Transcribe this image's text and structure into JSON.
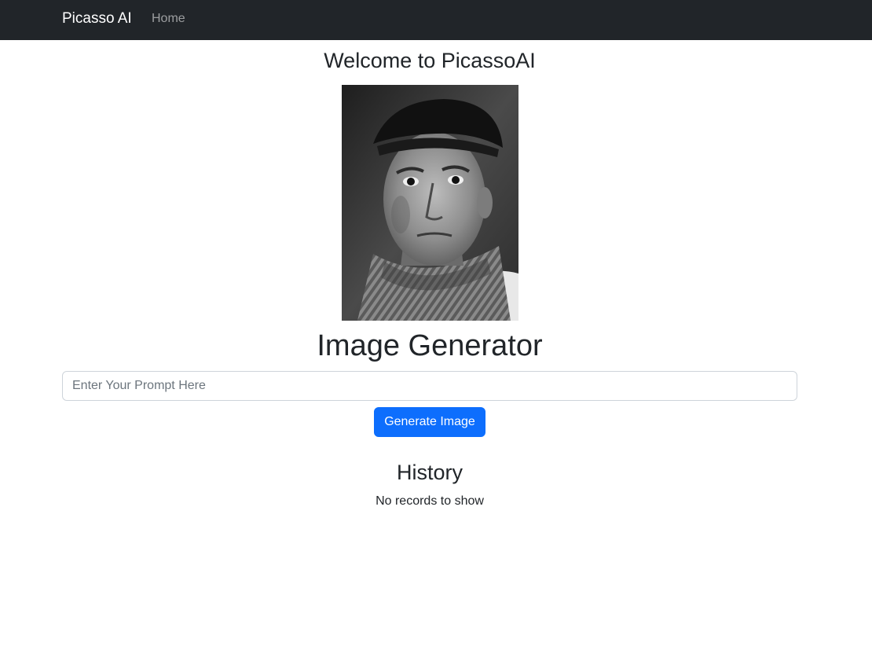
{
  "navbar": {
    "brand": "Picasso AI",
    "links": [
      "Home"
    ]
  },
  "main": {
    "welcome": "Welcome to PicassoAI",
    "portrait_alt": "Portrait photo of Pablo Picasso",
    "title": "Image Generator",
    "prompt": {
      "placeholder": "Enter Your Prompt Here",
      "value": ""
    },
    "generate_button": "Generate Image"
  },
  "history": {
    "title": "History",
    "empty_text": "No records to show"
  },
  "colors": {
    "navbar_bg": "#212529",
    "primary": "#0d6efd"
  }
}
